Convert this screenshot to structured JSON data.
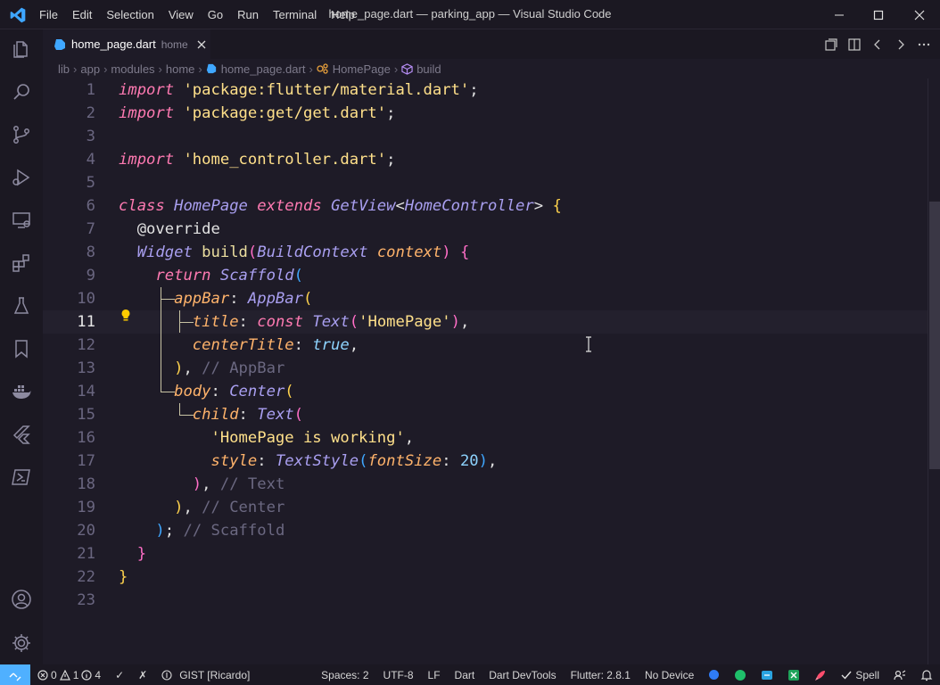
{
  "titlebar": {
    "menus": [
      "File",
      "Edit",
      "Selection",
      "View",
      "Go",
      "Run",
      "Terminal",
      "Help"
    ],
    "window_title": "home_page.dart — parking_app — Visual Studio Code"
  },
  "activity_bar": [
    "explorer-icon",
    "search-icon",
    "source-control-icon",
    "run-debug-icon",
    "remote-explorer-icon",
    "extensions-icon",
    "testing-icon",
    "bookmarks-icon",
    "docker-icon",
    "flutter-icon",
    "powershell-icon",
    "account-icon",
    "settings-gear-icon"
  ],
  "tab": {
    "filename": "home_page.dart",
    "description": "home"
  },
  "breadcrumb": [
    "lib",
    "app",
    "modules",
    "home",
    "home_page.dart",
    "HomePage",
    "build"
  ],
  "editor": {
    "current_line": 11,
    "lines": [
      {
        "n": "1",
        "tokens": [
          {
            "c": "kw",
            "t": "import"
          },
          {
            "c": "pl",
            "t": " "
          },
          {
            "c": "str",
            "t": "'package:flutter/material.dart'"
          },
          {
            "c": "pl",
            "t": ";"
          }
        ]
      },
      {
        "n": "2",
        "tokens": [
          {
            "c": "kw",
            "t": "import"
          },
          {
            "c": "pl",
            "t": " "
          },
          {
            "c": "str",
            "t": "'package:get/get.dart'"
          },
          {
            "c": "pl",
            "t": ";"
          }
        ]
      },
      {
        "n": "3",
        "tokens": []
      },
      {
        "n": "4",
        "tokens": [
          {
            "c": "kw",
            "t": "import"
          },
          {
            "c": "pl",
            "t": " "
          },
          {
            "c": "str",
            "t": "'home_controller.dart'"
          },
          {
            "c": "pl",
            "t": ";"
          }
        ]
      },
      {
        "n": "5",
        "tokens": []
      },
      {
        "n": "6",
        "tokens": [
          {
            "c": "kw",
            "t": "class"
          },
          {
            "c": "pl",
            "t": " "
          },
          {
            "c": "cls",
            "t": "HomePage"
          },
          {
            "c": "pl",
            "t": " "
          },
          {
            "c": "kw",
            "t": "extends"
          },
          {
            "c": "pl",
            "t": " "
          },
          {
            "c": "cls",
            "t": "GetView"
          },
          {
            "c": "pl",
            "t": "<"
          },
          {
            "c": "cls",
            "t": "HomeController"
          },
          {
            "c": "pl",
            "t": "> "
          },
          {
            "c": "b1",
            "t": "{"
          }
        ]
      },
      {
        "n": "7",
        "tokens": [
          {
            "c": "pl",
            "t": "  "
          },
          {
            "c": "ann",
            "t": "@override"
          }
        ]
      },
      {
        "n": "8",
        "tokens": [
          {
            "c": "pl",
            "t": "  "
          },
          {
            "c": "cls",
            "t": "Widget"
          },
          {
            "c": "pl",
            "t": " "
          },
          {
            "c": "fn",
            "t": "build"
          },
          {
            "c": "b2",
            "t": "("
          },
          {
            "c": "cls",
            "t": "BuildContext"
          },
          {
            "c": "pl",
            "t": " "
          },
          {
            "c": "prm",
            "t": "context"
          },
          {
            "c": "b2",
            "t": ")"
          },
          {
            "c": "pl",
            "t": " "
          },
          {
            "c": "b2",
            "t": "{"
          }
        ]
      },
      {
        "n": "9",
        "tokens": [
          {
            "c": "pl",
            "t": "    "
          },
          {
            "c": "kw",
            "t": "return"
          },
          {
            "c": "pl",
            "t": " "
          },
          {
            "c": "cls",
            "t": "Scaffold"
          },
          {
            "c": "b3",
            "t": "("
          }
        ]
      },
      {
        "n": "10",
        "tokens": [
          {
            "c": "pl",
            "t": "      "
          },
          {
            "c": "prm",
            "t": "appBar"
          },
          {
            "c": "pl",
            "t": ": "
          },
          {
            "c": "cls",
            "t": "AppBar"
          },
          {
            "c": "b1",
            "t": "("
          }
        ]
      },
      {
        "n": "11",
        "tokens": [
          {
            "c": "pl",
            "t": "        "
          },
          {
            "c": "prm",
            "t": "title"
          },
          {
            "c": "pl",
            "t": ": "
          },
          {
            "c": "kw",
            "t": "const"
          },
          {
            "c": "pl",
            "t": " "
          },
          {
            "c": "cls",
            "t": "Text"
          },
          {
            "c": "b2",
            "t": "("
          },
          {
            "c": "str",
            "t": "'HomePage'"
          },
          {
            "c": "b2",
            "t": ")"
          },
          {
            "c": "pl",
            "t": ","
          }
        ]
      },
      {
        "n": "12",
        "tokens": [
          {
            "c": "pl",
            "t": "        "
          },
          {
            "c": "prm",
            "t": "centerTitle"
          },
          {
            "c": "pl",
            "t": ": "
          },
          {
            "c": "bool",
            "t": "true"
          },
          {
            "c": "pl",
            "t": ","
          }
        ]
      },
      {
        "n": "13",
        "tokens": [
          {
            "c": "pl",
            "t": "      "
          },
          {
            "c": "b1",
            "t": ")"
          },
          {
            "c": "pl",
            "t": ", "
          },
          {
            "c": "cm",
            "t": "// AppBar"
          }
        ]
      },
      {
        "n": "14",
        "tokens": [
          {
            "c": "pl",
            "t": "      "
          },
          {
            "c": "prm",
            "t": "body"
          },
          {
            "c": "pl",
            "t": ": "
          },
          {
            "c": "cls",
            "t": "Center"
          },
          {
            "c": "b1",
            "t": "("
          }
        ]
      },
      {
        "n": "15",
        "tokens": [
          {
            "c": "pl",
            "t": "        "
          },
          {
            "c": "prm",
            "t": "child"
          },
          {
            "c": "pl",
            "t": ": "
          },
          {
            "c": "cls",
            "t": "Text"
          },
          {
            "c": "b2",
            "t": "("
          }
        ]
      },
      {
        "n": "16",
        "tokens": [
          {
            "c": "pl",
            "t": "          "
          },
          {
            "c": "str",
            "t": "'HomePage is working'"
          },
          {
            "c": "pl",
            "t": ","
          }
        ]
      },
      {
        "n": "17",
        "tokens": [
          {
            "c": "pl",
            "t": "          "
          },
          {
            "c": "prm",
            "t": "style"
          },
          {
            "c": "pl",
            "t": ": "
          },
          {
            "c": "cls",
            "t": "TextStyle"
          },
          {
            "c": "b3",
            "t": "("
          },
          {
            "c": "prm",
            "t": "fontSize"
          },
          {
            "c": "pl",
            "t": ": "
          },
          {
            "c": "num",
            "t": "20"
          },
          {
            "c": "b3",
            "t": ")"
          },
          {
            "c": "pl",
            "t": ","
          }
        ]
      },
      {
        "n": "18",
        "tokens": [
          {
            "c": "pl",
            "t": "        "
          },
          {
            "c": "b2",
            "t": ")"
          },
          {
            "c": "pl",
            "t": ", "
          },
          {
            "c": "cm",
            "t": "// Text"
          }
        ]
      },
      {
        "n": "19",
        "tokens": [
          {
            "c": "pl",
            "t": "      "
          },
          {
            "c": "b1",
            "t": ")"
          },
          {
            "c": "pl",
            "t": ", "
          },
          {
            "c": "cm",
            "t": "// Center"
          }
        ]
      },
      {
        "n": "20",
        "tokens": [
          {
            "c": "pl",
            "t": "    "
          },
          {
            "c": "b3",
            "t": ")"
          },
          {
            "c": "pl",
            "t": "; "
          },
          {
            "c": "cm",
            "t": "// Scaffold"
          }
        ]
      },
      {
        "n": "21",
        "tokens": [
          {
            "c": "pl",
            "t": "  "
          },
          {
            "c": "b2",
            "t": "}"
          }
        ]
      },
      {
        "n": "22",
        "tokens": [
          {
            "c": "b1",
            "t": "}"
          }
        ]
      },
      {
        "n": "23",
        "tokens": []
      }
    ]
  },
  "statusbar": {
    "errors": "0",
    "warnings": "1",
    "infos": "4",
    "check": "✓",
    "cross": "✗",
    "gist": "GIST [Ricardo]",
    "spaces": "Spaces: 2",
    "encoding": "UTF-8",
    "eol": "LF",
    "language": "Dart",
    "devtools": "Dart DevTools",
    "flutter": "Flutter: 2.8.1",
    "device": "No Device",
    "spell": "Spell"
  },
  "colors": {
    "editor_bg": "#1e1b27",
    "chrome_bg": "#1b1822",
    "remote_accent": "#4fb0ff",
    "keyword": "#ff7ab2",
    "string": "#ffe08a",
    "class": "#a99ff0"
  }
}
